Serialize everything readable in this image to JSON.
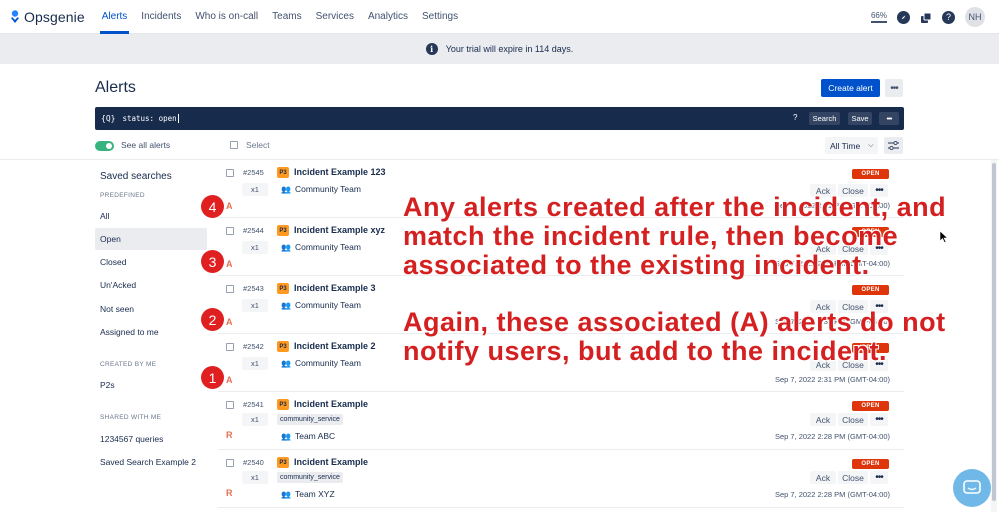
{
  "app": {
    "name": "Opsgenie"
  },
  "nav": {
    "items": [
      "Alerts",
      "Incidents",
      "Who is on-call",
      "Teams",
      "Services",
      "Analytics",
      "Settings"
    ],
    "active": "Alerts",
    "zoom": "66%",
    "avatar_initials": "NH"
  },
  "banner": {
    "text": "Your trial will expire in 114 days."
  },
  "page": {
    "title": "Alerts",
    "create_label": "Create alert"
  },
  "query": {
    "prefix": "{Q}",
    "value": "status: open",
    "help": "?",
    "search_label": "Search",
    "save_label": "Save"
  },
  "toolbar": {
    "see_all_label": "See all alerts",
    "select_label": "Select",
    "time_filter": "All Time"
  },
  "sidebar": {
    "title": "Saved searches",
    "sections": {
      "predefined": "PREDEFINED",
      "created_by_me": "CREATED BY ME",
      "shared_with_me": "SHARED WITH ME"
    },
    "predefined_items": [
      "All",
      "Open",
      "Closed",
      "Un'Acked",
      "Not seen",
      "Assigned to me"
    ],
    "active_item": "Open",
    "created_items": [
      "P2s"
    ],
    "shared_items": [
      "1234567 queries",
      "Saved Search Example 2"
    ]
  },
  "alerts": [
    {
      "tiny_id": "#2545",
      "priority": "P3",
      "message": "Incident Example 123",
      "count": "x1",
      "team": "Community Team",
      "tag": "",
      "status": "OPEN",
      "letter": "A",
      "date": "Sep 7, 2022 2:31 PM (GMT-04:00)"
    },
    {
      "tiny_id": "#2544",
      "priority": "P3",
      "message": "Incident Example xyz",
      "count": "x1",
      "team": "Community Team",
      "tag": "",
      "status": "OPEN",
      "letter": "A",
      "date": "Sep 7, 2022 2:31 PM (GMT-04:00)"
    },
    {
      "tiny_id": "#2543",
      "priority": "P3",
      "message": "Incident Example 3",
      "count": "x1",
      "team": "Community Team",
      "tag": "",
      "status": "OPEN",
      "letter": "A",
      "date": "Sep 7, 2022 2:31 PM (GMT-04:00)"
    },
    {
      "tiny_id": "#2542",
      "priority": "P3",
      "message": "Incident Example 2",
      "count": "x1",
      "team": "Community Team",
      "tag": "",
      "status": "OPEN",
      "letter": "A",
      "date": "Sep 7, 2022 2:31 PM (GMT-04:00)"
    },
    {
      "tiny_id": "#2541",
      "priority": "P3",
      "message": "Incident Example",
      "count": "x1",
      "team": "Team ABC",
      "tag": "community_service",
      "status": "OPEN",
      "letter": "R",
      "date": "Sep 7, 2022 2:28 PM (GMT-04:00)"
    },
    {
      "tiny_id": "#2540",
      "priority": "P3",
      "message": "Incident Example",
      "count": "x1",
      "team": "Team XYZ",
      "tag": "community_service",
      "status": "OPEN",
      "letter": "R",
      "date": "Sep 7, 2022 2:28 PM (GMT-04:00)"
    }
  ],
  "row_actions": {
    "ack": "Ack",
    "close": "Close"
  },
  "annotation": {
    "numbers": [
      "4",
      "3",
      "2",
      "1"
    ],
    "line1": "Any alerts created after the incident, and",
    "line2": "match the incident rule, then become",
    "line3": "associated to the existing incident.",
    "line4": "Again, these associated (A) alerts do not",
    "line5": "notify users, but add to the incident."
  },
  "colors": {
    "accent": "#0052CC",
    "status_open": "#DE350B",
    "priority_p3": "#FF991F",
    "annotation": "#D42020"
  }
}
